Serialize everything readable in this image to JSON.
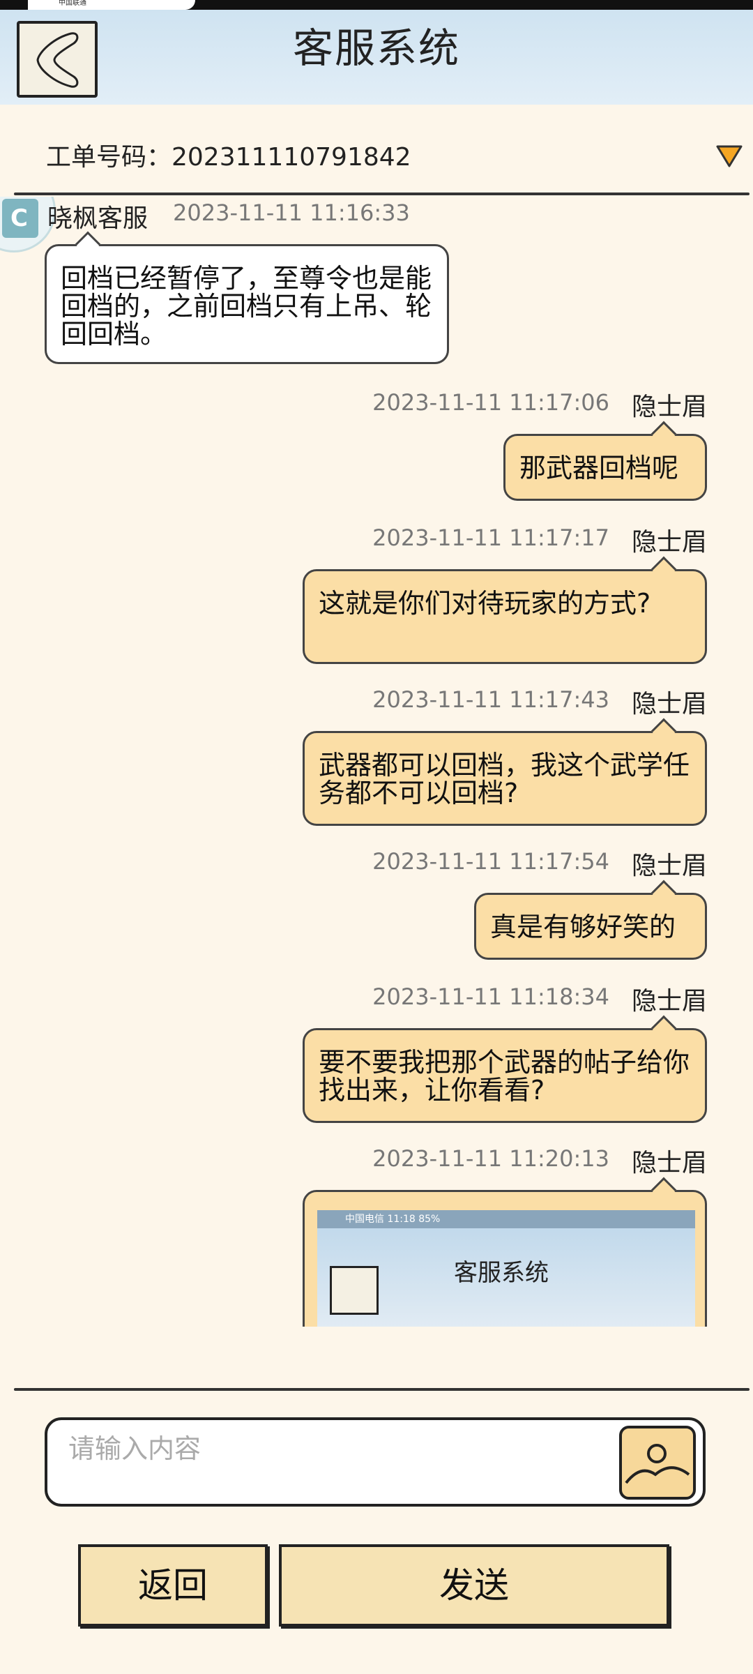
{
  "status": {
    "carrier_text": "中国联通"
  },
  "header": {
    "title": "客服系统"
  },
  "ticket": {
    "label_text": "工单号码：202311110791842"
  },
  "messages": [
    {
      "side": "left",
      "sender": "晓枫客服",
      "time": "2023-11-11 11:16:33",
      "text": "回档已经暂停了，至尊令也是能回档的，之前回档只有上吊、轮回回档。"
    },
    {
      "side": "right",
      "sender": "隐士眉",
      "time": "2023-11-11 11:17:06",
      "text": "那武器回档呢"
    },
    {
      "side": "right",
      "sender": "隐士眉",
      "time": "2023-11-11 11:17:17",
      "text": "这就是你们对待玩家的方式?"
    },
    {
      "side": "right",
      "sender": "隐士眉",
      "time": "2023-11-11 11:17:43",
      "text": "武器都可以回档，我这个武学任务都不可以回档?"
    },
    {
      "side": "right",
      "sender": "隐士眉",
      "time": "2023-11-11 11:17:54",
      "text": "真是有够好笑的"
    },
    {
      "side": "right",
      "sender": "隐士眉",
      "time": "2023-11-11 11:18:34",
      "text": "要不要我把那个武器的帖子给你找出来，让你看看?"
    },
    {
      "side": "right",
      "sender": "隐士眉",
      "time": "2023-11-11 11:20:13",
      "image_title": "客服系统",
      "image_status": "中国电信 11:18 85%"
    }
  ],
  "input": {
    "placeholder": "请输入内容"
  },
  "buttons": {
    "back_label": "返回",
    "send_label": "发送"
  },
  "colors": {
    "accent": "#f7d89a",
    "bubble_right": "#fbdea6",
    "header": "#cfe3f1",
    "background": "#fdf6ea",
    "toggle": "#f5a623"
  },
  "icons": {
    "back": "back-arrow-icon",
    "dropdown": "triangle-down-icon",
    "image": "image-icon"
  }
}
